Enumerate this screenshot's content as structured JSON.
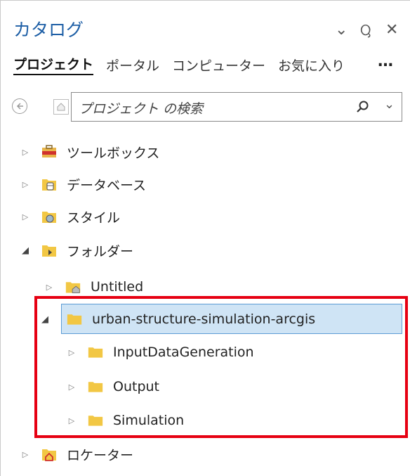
{
  "pane": {
    "title": "カタログ",
    "controls": {
      "dropdown": "⌄",
      "pin": "Ⴓ",
      "close": "✕"
    },
    "tabs": [
      {
        "label": "プロジェクト",
        "active": true
      },
      {
        "label": "ポータル",
        "active": false
      },
      {
        "label": "コンピューター",
        "active": false
      },
      {
        "label": "お気に入り",
        "active": false
      }
    ],
    "more_label": "…",
    "search": {
      "placeholder": "プロジェクト の検索",
      "dropdown": "⌄"
    },
    "tree": [
      {
        "label": "ツールボックス",
        "expanded": false,
        "icon": "toolbox-icon"
      },
      {
        "label": "データベース",
        "expanded": false,
        "icon": "database-icon"
      },
      {
        "label": "スタイル",
        "expanded": false,
        "icon": "style-icon"
      },
      {
        "label": "フォルダー",
        "expanded": true,
        "icon": "folder-connection-icon"
      },
      {
        "label": "Untitled",
        "expanded": false,
        "icon": "home-folder-icon"
      },
      {
        "label": "urban-structure-simulation-arcgis",
        "expanded": true,
        "icon": "folder-icon",
        "selected": true
      },
      {
        "label": "InputDataGeneration",
        "expanded": false,
        "icon": "folder-icon"
      },
      {
        "label": "Output",
        "expanded": false,
        "icon": "folder-icon"
      },
      {
        "label": "Simulation",
        "expanded": false,
        "icon": "folder-icon"
      },
      {
        "label": "ロケーター",
        "expanded": false,
        "icon": "locator-icon"
      }
    ]
  },
  "colors": {
    "title": "#1e5fa6",
    "selection": "#cfe4f5",
    "highlight_box": "#e60012",
    "folder": "#f2c744"
  }
}
